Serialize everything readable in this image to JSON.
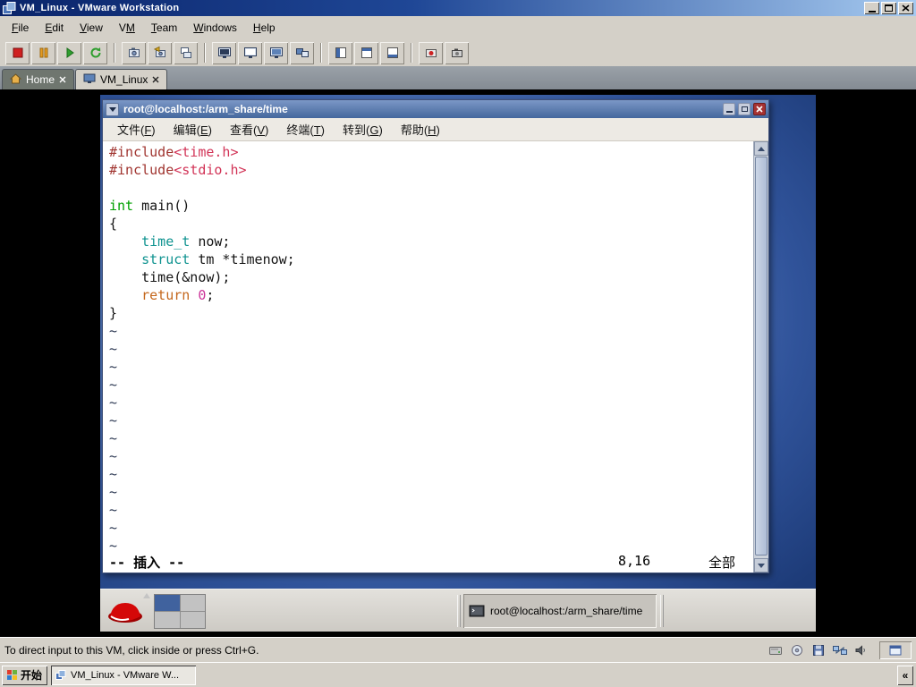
{
  "vmware": {
    "title": "VM_Linux - VMware Workstation",
    "menus": [
      {
        "name": "file",
        "pre": "",
        "key": "F",
        "post": "ile"
      },
      {
        "name": "edit",
        "pre": "",
        "key": "E",
        "post": "dit"
      },
      {
        "name": "view",
        "pre": "",
        "key": "V",
        "post": "iew"
      },
      {
        "name": "vm",
        "pre": "V",
        "key": "M",
        "post": ""
      },
      {
        "name": "team",
        "pre": "",
        "key": "T",
        "post": "eam"
      },
      {
        "name": "windows",
        "pre": "",
        "key": "W",
        "post": "indows"
      },
      {
        "name": "help",
        "pre": "",
        "key": "H",
        "post": "elp"
      }
    ],
    "tabs": [
      {
        "label": "Home"
      },
      {
        "label": "VM_Linux"
      }
    ],
    "status_message": "To direct input to this VM, click inside or press Ctrl+G."
  },
  "terminal": {
    "title": "root@localhost:/arm_share/time",
    "menus": [
      {
        "name": "file",
        "pre": "文件(",
        "key": "F",
        "post": ")"
      },
      {
        "name": "edit",
        "pre": "编辑(",
        "key": "E",
        "post": ")"
      },
      {
        "name": "view",
        "pre": "查看(",
        "key": "V",
        "post": ")"
      },
      {
        "name": "terminal",
        "pre": "终端(",
        "key": "T",
        "post": ")"
      },
      {
        "name": "go",
        "pre": "转到(",
        "key": "G",
        "post": ")"
      },
      {
        "name": "help",
        "pre": "帮助(",
        "key": "H",
        "post": ")"
      }
    ],
    "lines": [
      [
        [
          "pp",
          "#include"
        ],
        [
          "str",
          "<time.h>"
        ]
      ],
      [
        [
          "pp",
          "#include"
        ],
        [
          "str",
          "<stdio.h>"
        ]
      ],
      [],
      [
        [
          "type",
          "int"
        ],
        [
          "pl",
          " main()"
        ]
      ],
      [
        [
          "pl",
          "{"
        ]
      ],
      [
        [
          "pl",
          "    "
        ],
        [
          "type2",
          "time_t"
        ],
        [
          "pl",
          " now;"
        ]
      ],
      [
        [
          "pl",
          "    "
        ],
        [
          "type2",
          "struct"
        ],
        [
          "pl",
          " tm *timenow;"
        ]
      ],
      [
        [
          "pl",
          "    time(&now);"
        ]
      ],
      [
        [
          "pl",
          "    "
        ],
        [
          "stmt",
          "return"
        ],
        [
          "pl",
          " "
        ],
        [
          "num",
          "0"
        ],
        [
          "pl",
          ";"
        ]
      ],
      [
        [
          "pl",
          "}"
        ]
      ]
    ],
    "tilde": "~",
    "tilde_count": 13,
    "status_mode": "-- 插入 --",
    "status_pos": "8,16",
    "status_scroll": "全部"
  },
  "vm_taskbar": {
    "window_button": "root@localhost:/arm_share/time"
  },
  "win_taskbar": {
    "start": "开始",
    "task": "VM_Linux - VMware W...",
    "overflow": "«"
  }
}
